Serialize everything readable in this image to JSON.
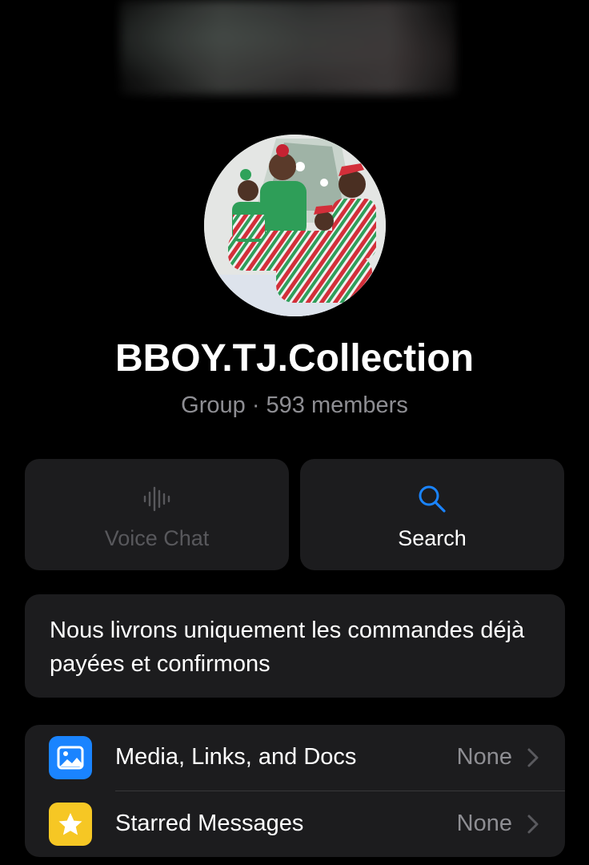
{
  "header": {
    "group_name": "BBOY.TJ.Collection",
    "subtitle": "Group · 593 members"
  },
  "actions": {
    "voice_chat": {
      "label": "Voice Chat",
      "icon": "waveform-icon",
      "enabled": false
    },
    "search": {
      "label": "Search",
      "icon": "search-icon",
      "enabled": true
    }
  },
  "description": {
    "text": "Nous livrons uniquement les commandes déjà payées et confirmons"
  },
  "list": [
    {
      "label": "Media, Links, and Docs",
      "value": "None",
      "icon": "photo-icon",
      "icon_color": "#1a84ff"
    },
    {
      "label": "Starred Messages",
      "value": "None",
      "icon": "star-icon",
      "icon_color": "#f6c724"
    }
  ],
  "colors": {
    "background": "#000000",
    "card": "#1c1c1e",
    "accent": "#1a84ff",
    "secondary_text": "#8e8e93",
    "disabled_text": "#58585c"
  }
}
